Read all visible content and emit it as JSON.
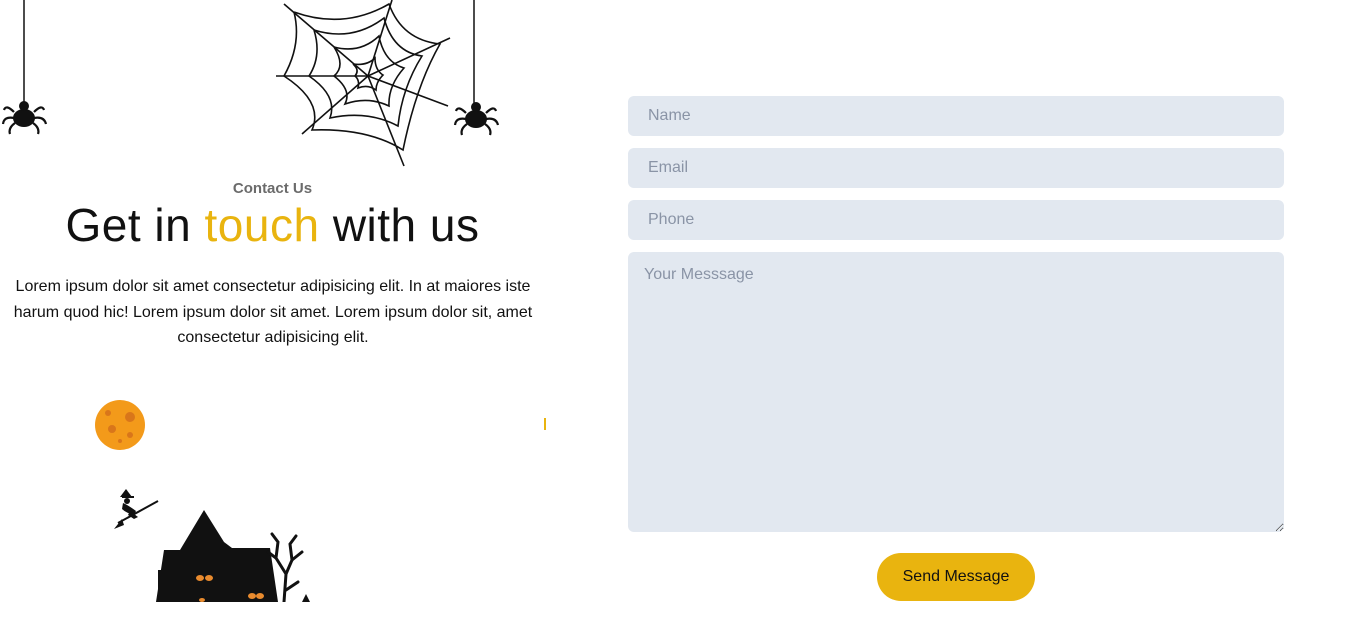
{
  "contact": {
    "eyebrow": "Contact Us",
    "headline_part1": "Get in ",
    "headline_accent": "touch",
    "headline_part2": " with us",
    "paragraph": "Lorem ipsum dolor sit amet consectetur adipisicing elit. In at maiores iste harum quod hic! Lorem ipsum dolor sit amet. Lorem ipsum dolor sit, amet consectetur adipisicing elit."
  },
  "form": {
    "name_placeholder": "Name",
    "email_placeholder": "Email",
    "phone_placeholder": "Phone",
    "message_placeholder": "Your Messsage",
    "send_label": "Send Message"
  },
  "colors": {
    "accent": "#e9b40f",
    "field_bg": "#e2e8f0",
    "moon": "#f39a1a"
  },
  "icons": [
    "spider-web-icon",
    "spider-icon",
    "moon-icon",
    "witch-on-broom-icon",
    "haunted-house-icon",
    "bare-tree-icon"
  ]
}
